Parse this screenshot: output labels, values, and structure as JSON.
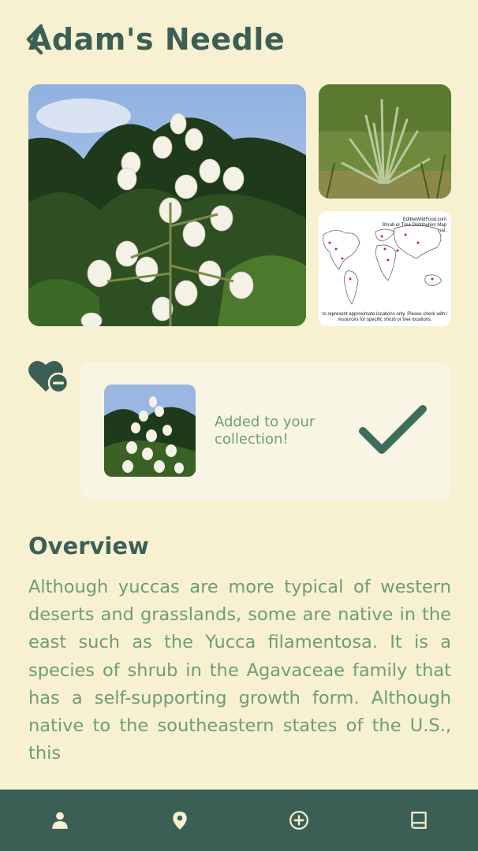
{
  "plant": {
    "name": "Adam's Needle"
  },
  "collection": {
    "status_message": "Added to your collection!"
  },
  "overview": {
    "heading": "Overview",
    "body": "Although yuccas are more typical of western deserts and grasslands, some are native in the east such as the Yucca filamentosa. It is a species of shrub in the Agavaceae family that has a self-supporting growth form. Although native to the southeastern states of the U.S., this"
  },
  "map_image": {
    "header_lines": [
      "EdibleWildFood.com",
      "Shrub or Tree Distribution Map",
      "nat."
    ],
    "footer_lines": [
      "to represent approximate locations only. Please check with l",
      "resources for specific shrub or tree locations."
    ]
  },
  "icons": {
    "back": "back-chevron-icon",
    "favorite": "heart-minus-icon",
    "confirm": "checkmark-icon",
    "nav": [
      "person-icon",
      "location-pin-icon",
      "add-circle-icon",
      "book-icon"
    ]
  },
  "colors": {
    "background": "#f7f1d1",
    "card": "#f9f5e4",
    "primary": "#3c5f55",
    "accent": "#6e9d78",
    "nav_bar": "#3c5f55",
    "nav_icon": "#f7f1d1"
  }
}
